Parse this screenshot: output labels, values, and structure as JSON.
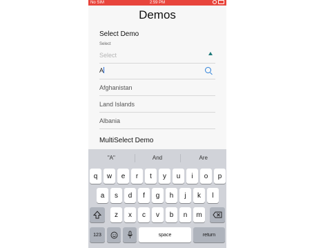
{
  "status_bar": {
    "carrier": "No SIM",
    "time": "2:59 PM"
  },
  "page_title": "Demos",
  "select_demo": {
    "heading": "Select Demo",
    "field_label": "Select",
    "placeholder": "Select",
    "search_value": "A",
    "options": [
      "Afghanistan",
      "Land Islands",
      "Albania"
    ]
  },
  "multiselect_demo": {
    "heading": "MultiSelect Demo"
  },
  "keyboard": {
    "suggestions": [
      "\"A\"",
      "And",
      "Are"
    ],
    "row1": [
      "q",
      "w",
      "e",
      "r",
      "t",
      "y",
      "u",
      "i",
      "o",
      "p"
    ],
    "row2": [
      "a",
      "s",
      "d",
      "f",
      "g",
      "h",
      "j",
      "k",
      "l"
    ],
    "row3": [
      "z",
      "x",
      "c",
      "v",
      "b",
      "n",
      "m"
    ],
    "numbers_key": "123",
    "space_key": "space",
    "return_key": "return",
    "shift_icon": "shift-icon",
    "delete_icon": "backspace-icon",
    "emoji_icon": "emoji-icon",
    "mic_icon": "microphone-icon"
  },
  "colors": {
    "status_bar": "#e8453c",
    "accent": "#1f7a7a",
    "search_icon": "#2a7fd8"
  }
}
